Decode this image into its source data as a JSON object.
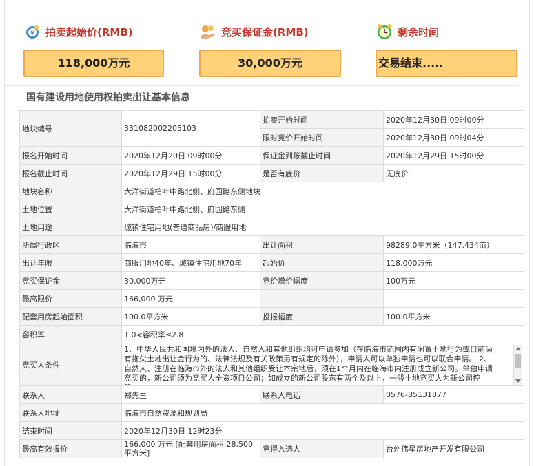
{
  "stats": {
    "start_price": {
      "label": "拍卖起始价(RMB)",
      "value": "118,000万元",
      "icon": "money-bag-icon"
    },
    "deposit": {
      "label": "竞买保证金(RMB)",
      "value": "30,000万元",
      "icon": "hand-coins-icon"
    },
    "remaining": {
      "label": "剩余时间",
      "value": "交易结束.....",
      "icon": "alarm-clock-icon"
    }
  },
  "section_title": "国有建设用地使用权拍卖出让基本信息",
  "rows": {
    "parcel_no": {
      "k": "地块编号",
      "v": "331082002205103"
    },
    "auction_start": {
      "k": "拍卖开始时间",
      "v": "2020年12月30日 09时00分"
    },
    "timed_start": {
      "k": "限时竞价开始时间",
      "v": "2020年12月30日 09时04分"
    },
    "reg_start": {
      "k": "报名开始时间",
      "v": "2020年12月20日 09时00分"
    },
    "deposit_deadline": {
      "k": "保证金到账截止时间",
      "v": "2020年12月29日 15时00分"
    },
    "reg_end": {
      "k": "报名截止时间",
      "v": "2020年12月29日 15时00分"
    },
    "reserve": {
      "k": "是否有底价",
      "v": "无底价"
    },
    "parcel_name": {
      "k": "地块名称",
      "v": "大洋街道柏叶中路北侧、府园路东侧地块"
    },
    "location": {
      "k": "土地位置",
      "v": "大洋街道柏叶中路北侧、府园路东侧"
    },
    "usage": {
      "k": "土地用途",
      "v": "城镇住宅用地(普通商品房)/商服用地"
    },
    "district": {
      "k": "所属行政区",
      "v": "临海市"
    },
    "area": {
      "k": "出让面积",
      "v": "98289.0平方米（147.434亩）"
    },
    "term": {
      "k": "出让年限",
      "v": "商服用地40年、城镇住宅用地70年"
    },
    "start_price": {
      "k": "起始价",
      "v": "118,000万元"
    },
    "deposit": {
      "k": "竞买保证金",
      "v": "30,000万元"
    },
    "increment": {
      "k": "竞价增价幅度",
      "v": "100万元"
    },
    "max_price": {
      "k": "最高限价",
      "v": "166,000 万元"
    },
    "housing_start": {
      "k": "配套用房起始面积",
      "v": "100.0平方米"
    },
    "bid_step": {
      "k": "投报幅度",
      "v": "100.0平方米"
    },
    "far": {
      "k": "容积率",
      "v": "1.0<容积率≤2.8"
    },
    "conditions": {
      "k": "竞买人条件",
      "v": "1、中华人民共和国境内外的法人、自然人和其他组织均可申请参加（在临海市范围内有闲置土地行为或目前尚有拖欠土地出让金行为的、法律法规及有关政策另有规定的除外），申请人可以单独申请也可以联合申请。 2、自然人、注册在临海市外的法人和其他组织受让本宗地后，须在1个月内在临海市内注册成立新公司。单独申请竞买的，新公司须为竞买人全资项目公司；如成立的新公司股东有两个及以上，一般土地竞买人为新公司控股..."
    },
    "contact": {
      "k": "联系人",
      "v": "郑先生"
    },
    "phone": {
      "k": "联系人电话",
      "v": "0576-85131877"
    },
    "address": {
      "k": "联系人地址",
      "v": "临海市自然资源和规划局"
    },
    "end_time": {
      "k": "结束时间",
      "v": "2020年12月30日 12时23分"
    },
    "best_offer": {
      "k": "最高有效报价",
      "v": "166,000 万元 [配套用房面积:28,500平方米]"
    },
    "winner": {
      "k": "竞得入选人",
      "v": "台州伟星房地产开发有限公司"
    }
  }
}
